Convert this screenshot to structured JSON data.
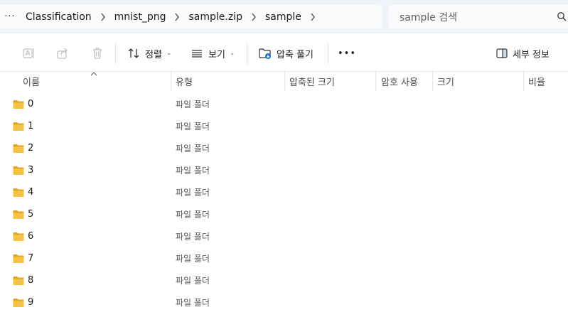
{
  "address_bar": {
    "more": "···",
    "breadcrumbs": [
      "Classification",
      "mnist_png",
      "sample.zip",
      "sample"
    ]
  },
  "search": {
    "placeholder": "sample 검색"
  },
  "toolbar": {
    "sort_label": "정렬",
    "view_label": "보기",
    "extract_label": "압축 풀기",
    "more": "•••",
    "details_label": "세부 정보"
  },
  "columns": {
    "name": "이름",
    "type": "유형",
    "compressed_size": "압축된 크기",
    "password": "암호 사용",
    "size": "크기",
    "ratio": "비율"
  },
  "files": [
    {
      "name": "0",
      "type": "파일 폴더"
    },
    {
      "name": "1",
      "type": "파일 폴더"
    },
    {
      "name": "2",
      "type": "파일 폴더"
    },
    {
      "name": "3",
      "type": "파일 폴더"
    },
    {
      "name": "4",
      "type": "파일 폴더"
    },
    {
      "name": "5",
      "type": "파일 폴더"
    },
    {
      "name": "6",
      "type": "파일 폴더"
    },
    {
      "name": "7",
      "type": "파일 폴더"
    },
    {
      "name": "8",
      "type": "파일 폴더"
    },
    {
      "name": "9",
      "type": "파일 폴더"
    }
  ],
  "colors": {
    "folder": "#f5c343",
    "folder_dark": "#e2a727",
    "accent": "#1d6fcf"
  }
}
